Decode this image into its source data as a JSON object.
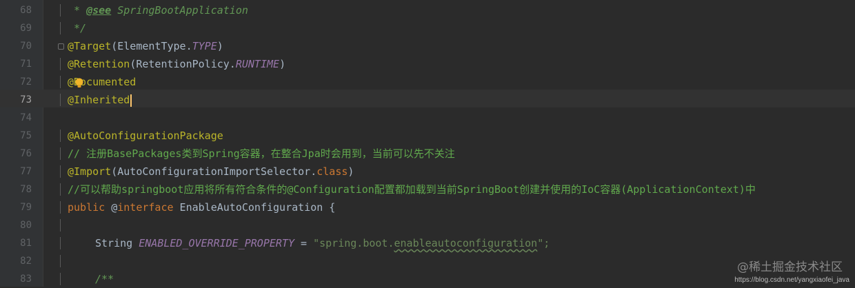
{
  "editor": {
    "lines": [
      {
        "num": "68",
        "parts": [
          {
            "t": " * ",
            "c": "c-comment-doc"
          },
          {
            "t": "@see",
            "c": "c-doc-tag"
          },
          {
            "t": " SpringBootApplication",
            "c": "c-doc-ref"
          }
        ]
      },
      {
        "num": "69",
        "parts": [
          {
            "t": " */",
            "c": "c-comment-doc"
          }
        ]
      },
      {
        "num": "70",
        "parts": [
          {
            "t": "@Target",
            "c": "c-ann"
          },
          {
            "t": "(ElementType.",
            "c": "c-plain"
          },
          {
            "t": "TYPE",
            "c": "c-static"
          },
          {
            "t": ")",
            "c": "c-plain"
          }
        ]
      },
      {
        "num": "71",
        "parts": [
          {
            "t": "@Retention",
            "c": "c-ann"
          },
          {
            "t": "(RetentionPolicy.",
            "c": "c-plain"
          },
          {
            "t": "RUNTIME",
            "c": "c-static"
          },
          {
            "t": ")",
            "c": "c-plain"
          }
        ]
      },
      {
        "num": "72",
        "parts": [
          {
            "t": "@Documented",
            "c": "c-ann"
          }
        ]
      },
      {
        "num": "73",
        "parts": [
          {
            "t": "@Inherited",
            "c": "c-ann"
          }
        ]
      },
      {
        "num": "74",
        "parts": []
      },
      {
        "num": "75",
        "parts": [
          {
            "t": "@AutoConfigurationPackage",
            "c": "c-ann"
          }
        ]
      },
      {
        "num": "76",
        "parts": [
          {
            "t": "// 注册BasePackages类到Spring容器，在整合Jpa时会用到，当前可以先不关注",
            "c": "c-comment"
          }
        ]
      },
      {
        "num": "77",
        "parts": [
          {
            "t": "@Import",
            "c": "c-ann"
          },
          {
            "t": "(AutoConfigurationImportSelector.",
            "c": "c-plain"
          },
          {
            "t": "class",
            "c": "c-kw"
          },
          {
            "t": ")",
            "c": "c-plain"
          }
        ]
      },
      {
        "num": "78",
        "parts": [
          {
            "t": "//可以帮助springboot应用将所有符合条件的@Configuration配置都加载到当前SpringBoot创建并使用的IoC容器(ApplicationContext)中",
            "c": "c-comment"
          }
        ]
      },
      {
        "num": "79",
        "parts": [
          {
            "t": "public ",
            "c": "c-kw"
          },
          {
            "t": "@",
            "c": "c-plain"
          },
          {
            "t": "interface",
            "c": "c-kw"
          },
          {
            "t": " EnableAutoConfiguration {",
            "c": "c-plain"
          }
        ]
      },
      {
        "num": "80",
        "parts": []
      },
      {
        "num": "81",
        "indent": true,
        "parts": [
          {
            "t": "String ",
            "c": "c-plain"
          },
          {
            "t": "ENABLED_OVERRIDE_PROPERTY",
            "c": "c-field"
          },
          {
            "t": " = ",
            "c": "c-plain"
          },
          {
            "t": "\"spring.boot.",
            "c": "c-string"
          },
          {
            "t": "enableautoconfiguration",
            "c": "c-string squiggle"
          },
          {
            "t": "\";",
            "c": "c-string"
          }
        ]
      },
      {
        "num": "82",
        "parts": []
      },
      {
        "num": "83",
        "indent": true,
        "parts": [
          {
            "t": "/**",
            "c": "c-comment-doc"
          }
        ]
      }
    ],
    "current_line": "73"
  },
  "watermark": {
    "text": "@稀土掘金技术社区",
    "url": "https://blog.csdn.net/yangxiaofei_java"
  },
  "colors": {
    "background": "#2b2b2b",
    "gutter": "#313335",
    "annotation": "#bbb529",
    "keyword": "#cc7832",
    "comment": "#61a94d",
    "string": "#6a8759",
    "static_field": "#9876aa"
  }
}
